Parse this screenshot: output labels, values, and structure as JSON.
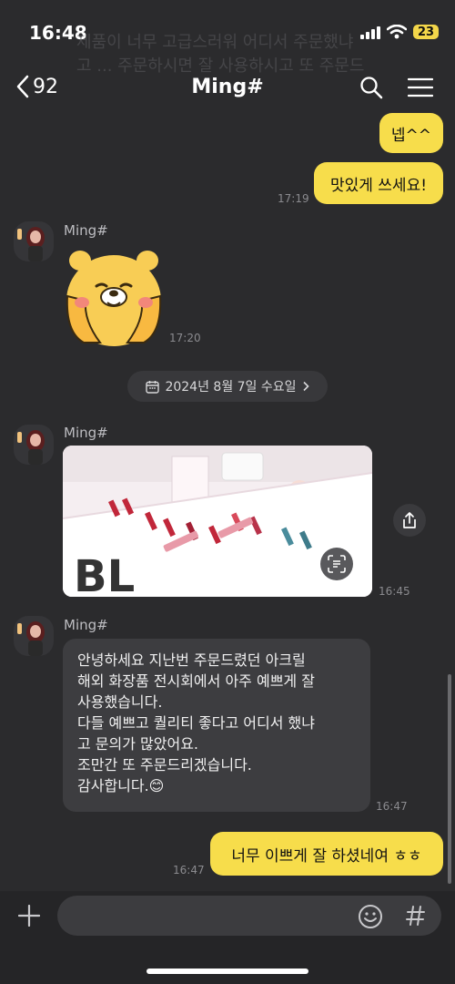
{
  "status": {
    "time": "16:48",
    "battery": "23"
  },
  "header": {
    "back_count": "92",
    "title": "Ming#"
  },
  "faded_text": "제품이 너무 고급스러워 어디서 주문했냐고 ... 주문하시면 잘 사용하시고 또 주문드리겠습니다",
  "messages": {
    "m1_text": "넵^^",
    "m2_text": "맛있게 쓰세요!",
    "m2_time": "17:19",
    "sender_name": "Ming#",
    "sticker_time": "17:20",
    "date_divider": "2024년 8월 7일 수요일",
    "photo_time": "16:45",
    "text_lines": [
      "안녕하세요 지난번 주문드렸던 아크릴",
      "해외 화장품 전시회에서 아주 예쁘게 잘",
      "사용했습니다.",
      "다들 예쁘고 퀄리티 좋다고 어디서 했냐",
      "고 문의가 많았어요.",
      "조만간 또 주문드리겠습니다.",
      "감사합니다.😊"
    ],
    "text_time": "16:47",
    "reply_text": "너무 이쁘게 잘 하셨네여 ㅎㅎ",
    "reply_time": "16:47"
  },
  "photo_sign": "BL",
  "colors": {
    "accent": "#f7dd4b",
    "background": "#2b2b2d",
    "other_bubble": "#3d3d40"
  }
}
